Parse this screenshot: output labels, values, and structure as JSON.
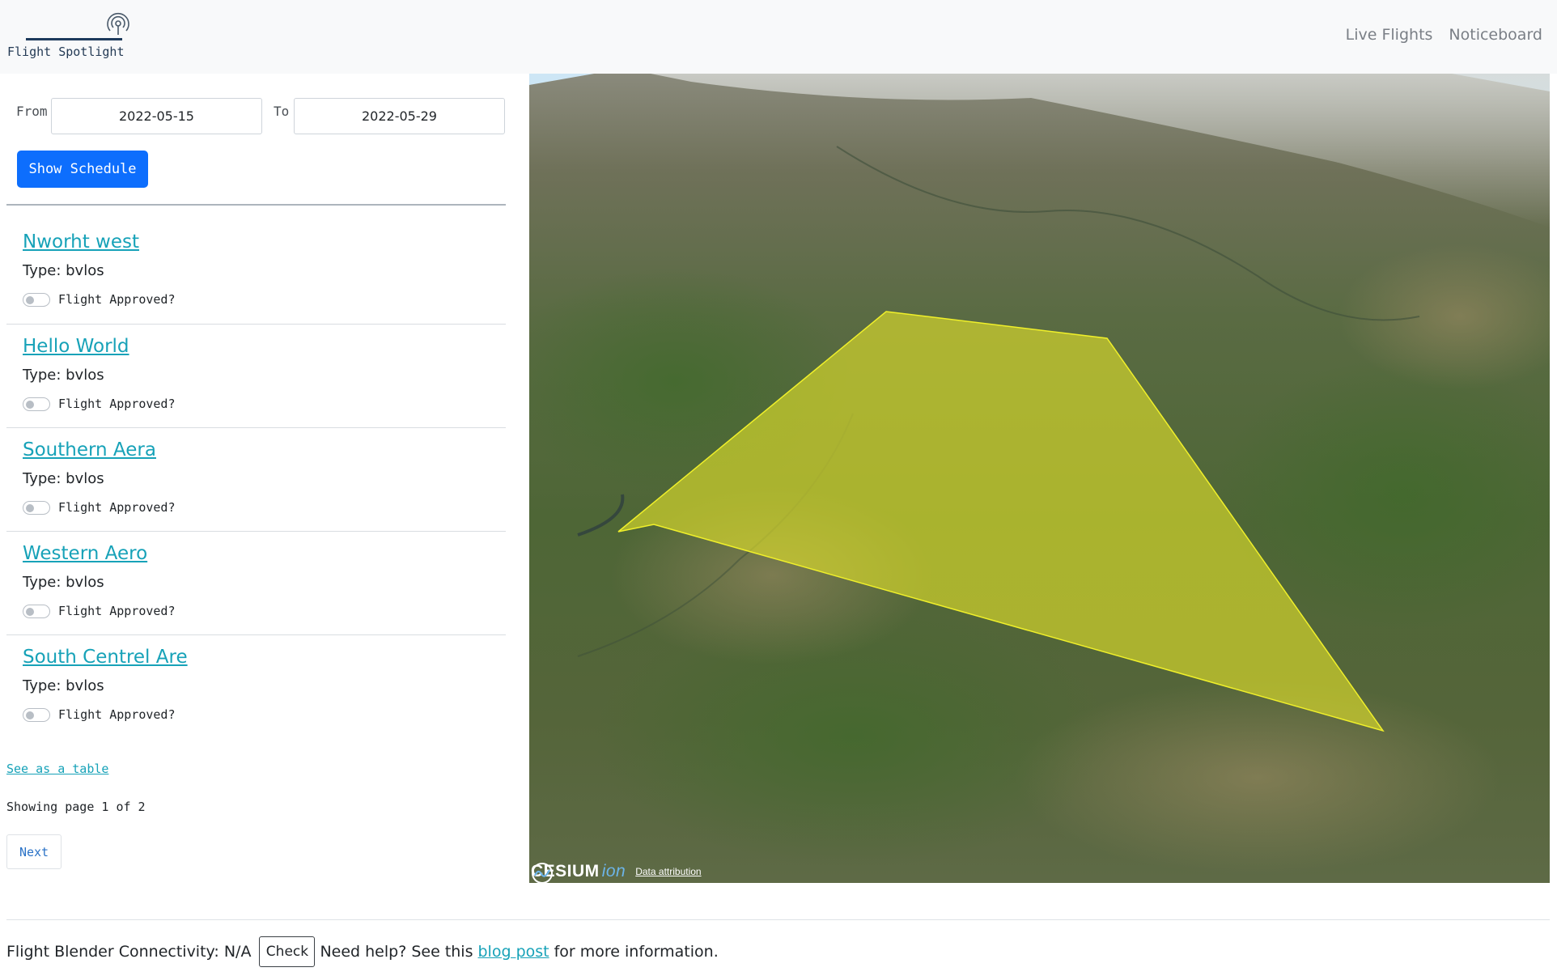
{
  "header": {
    "brand": "Flight Spotlight",
    "brand_icon": "broadcast-icon",
    "nav": [
      "Live Flights",
      "Noticeboard"
    ]
  },
  "filters": {
    "from_label": "From",
    "from_value": "2022-05-15",
    "to_label": "To",
    "to_value": "2022-05-29",
    "show_button": "Show Schedule"
  },
  "operations": [
    {
      "title": "Nworht west",
      "type": "Type: bvlos",
      "approved_label": "Flight Approved?",
      "approved": false
    },
    {
      "title": "Hello World",
      "type": "Type: bvlos",
      "approved_label": "Flight Approved?",
      "approved": false
    },
    {
      "title": "Southern Aera",
      "type": "Type: bvlos",
      "approved_label": "Flight Approved?",
      "approved": false
    },
    {
      "title": "Western Aero",
      "type": "Type: bvlos",
      "approved_label": "Flight Approved?",
      "approved": false
    },
    {
      "title": "South Centrel Are",
      "type": "Type: bvlos",
      "approved_label": "Flight Approved?",
      "approved": false
    }
  ],
  "pagination": {
    "see_table": "See as a table",
    "info": "Showing page 1 of 2",
    "next": "Next"
  },
  "map": {
    "brand": "CESIUM",
    "brand_suffix": "ion",
    "attribution": "Data attribution",
    "polygon_color": "#e2e22a"
  },
  "footer": {
    "connectivity": "Flight Blender Connectivity: N/A",
    "check_button": "Check",
    "help_prefix": "Need help? See this",
    "link_text": "blog post",
    "help_suffix": "for more information."
  }
}
